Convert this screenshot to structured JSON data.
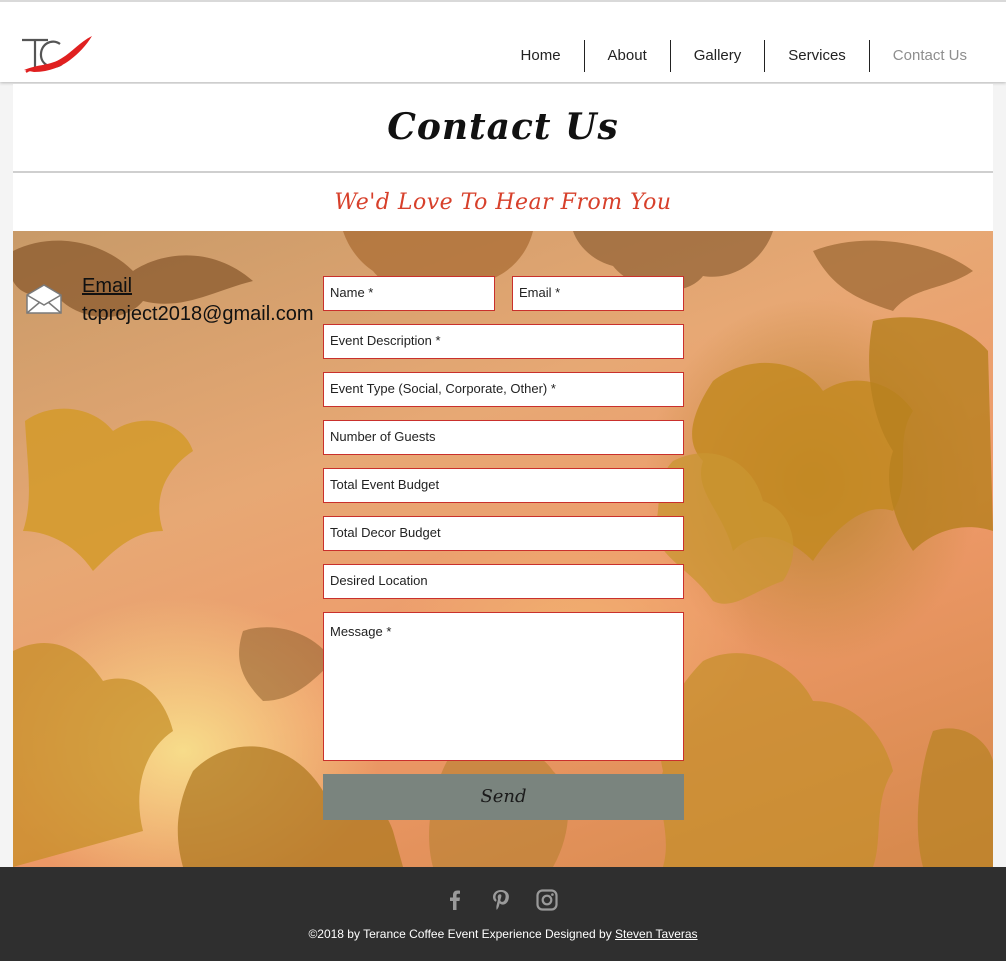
{
  "nav": {
    "items": [
      {
        "label": "Home",
        "active": false
      },
      {
        "label": "About",
        "active": false
      },
      {
        "label": "Gallery",
        "active": false
      },
      {
        "label": "Services",
        "active": false
      },
      {
        "label": "Contact Us",
        "active": true
      }
    ]
  },
  "header": {
    "logo_icon": "tc-logo-icon"
  },
  "panel": {
    "title": "Contact Us",
    "subtitle": "We'd Love To Hear From You"
  },
  "contact": {
    "icon": "envelope-icon",
    "email_label": "Email",
    "email_value": "tcproject2018@gmail.com"
  },
  "form": {
    "name_placeholder": "Name *",
    "email_placeholder": "Email *",
    "event_description_placeholder": "Event Description *",
    "event_type_placeholder": "Event Type (Social, Corporate, Other) *",
    "guests_placeholder": "Number of Guests",
    "event_budget_placeholder": "Total Event Budget",
    "decor_budget_placeholder": "Total Decor Budget",
    "location_placeholder": "Desired Location",
    "message_placeholder": "Message *",
    "send_label": "Send"
  },
  "footer": {
    "social": [
      "facebook-icon",
      "pinterest-icon",
      "instagram-icon"
    ],
    "copyright": "©2018 by Terance Coffee Event Experience Designed by",
    "designer": "Steven Taveras"
  },
  "colors": {
    "accent_red": "#d7402b",
    "field_border": "#c9302c",
    "send_button": "#7a847e",
    "footer_bg": "#2f2f2f",
    "nav_active": "#8e8e8e"
  }
}
